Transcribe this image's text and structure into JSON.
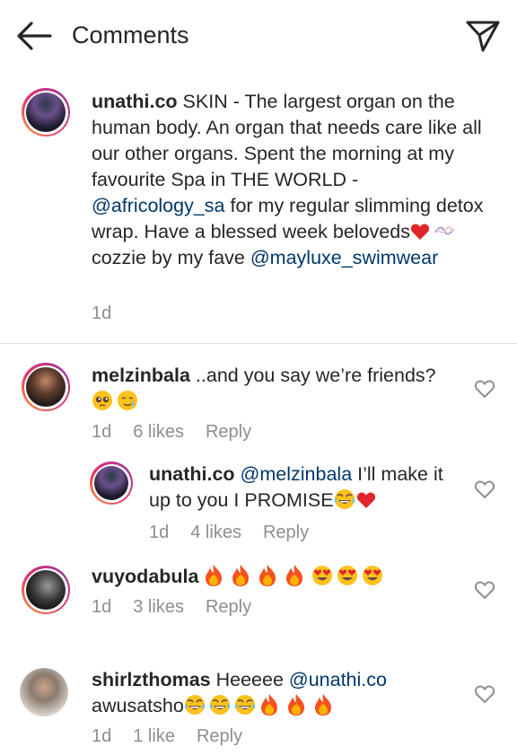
{
  "header": {
    "title": "Comments"
  },
  "caption": {
    "username": "unathi.co",
    "text_1": "SKIN - The largest organ on the human body. An organ that needs care like all our other organs. Spent the morning at my favourite Spa in THE WORLD - ",
    "mention_1": "@africology_sa",
    "text_2": " for my regular slimming detox wrap. Have a blessed week beloveds",
    "text_3": " cozzie by my fave ",
    "mention_2": "@mayluxe_swimwear",
    "time": "1d"
  },
  "comments": [
    {
      "username": "melzinbala",
      "text": " ..and you say we’re friends?",
      "time": "1d",
      "likes": "6 likes",
      "reply": "Reply",
      "reply_thread": {
        "username": "unathi.co",
        "mention": "@melzinbala",
        "text": " I’ll make it up to you I PROMISE",
        "time": "1d",
        "likes": "4 likes",
        "reply": "Reply"
      }
    },
    {
      "username": "vuyodabula",
      "text": " ",
      "time": "1d",
      "likes": "3 likes",
      "reply": "Reply"
    },
    {
      "username": "shirlzthomas",
      "text": " Heeeee ",
      "mention": "@unathi.co",
      "text_2": "awusatsho",
      "time": "1d",
      "likes": "1 like",
      "reply": "Reply"
    }
  ],
  "icons": {
    "back": "arrow-left-icon",
    "send": "paper-plane-icon",
    "like": "heart-outline-icon"
  },
  "colors": {
    "mention": "#00376b",
    "meta": "#8e8e8e",
    "heart": "#e0262b"
  }
}
